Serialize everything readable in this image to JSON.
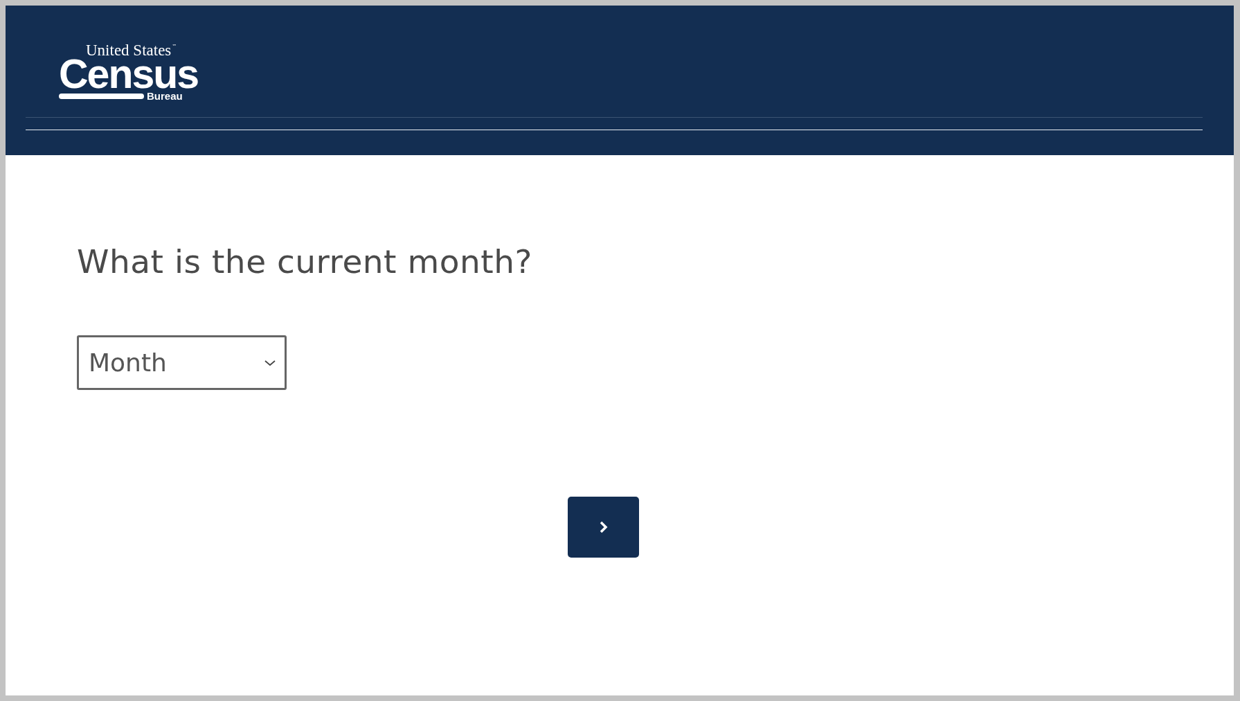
{
  "header": {
    "logo": {
      "top_line": "United States",
      "trademark": "™",
      "name": "Census",
      "bottom_line": "Bureau"
    }
  },
  "question": {
    "text": "What is the current month?"
  },
  "month_dropdown": {
    "value": "Month"
  },
  "next_button": {
    "disabled": false
  }
}
